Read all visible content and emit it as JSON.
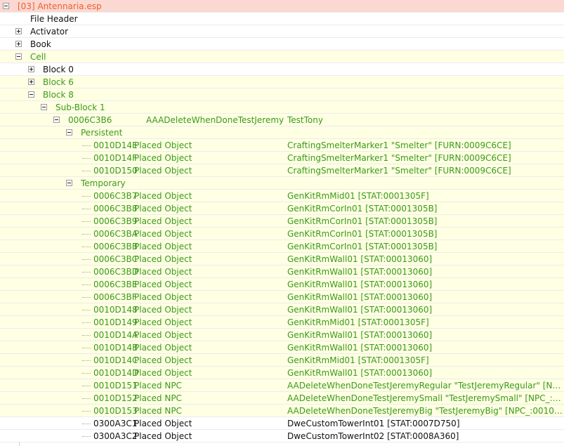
{
  "root": {
    "label": "[03] Antennaria.esp"
  },
  "top_items": {
    "file_header": "File Header",
    "activator": "Activator",
    "book": "Book",
    "cell": "Cell"
  },
  "blocks": {
    "block0": "Block 0",
    "block6": "Block 6",
    "block8": "Block 8",
    "subblock1": "Sub-Block 1"
  },
  "cell_record": {
    "form_id": "0006C3B6",
    "editor_id": "AAADeleteWhenDoneTestJeremy",
    "name": "TestTony"
  },
  "groups": {
    "persistent": "Persistent",
    "temporary": "Temporary"
  },
  "persistent_refs": [
    {
      "id": "0010D14E",
      "type": "Placed Object",
      "base": "CraftingSmelterMarker1 \"Smelter\" [FURN:0009C6CE]"
    },
    {
      "id": "0010D14F",
      "type": "Placed Object",
      "base": "CraftingSmelterMarker1 \"Smelter\" [FURN:0009C6CE]"
    },
    {
      "id": "0010D150",
      "type": "Placed Object",
      "base": "CraftingSmelterMarker1 \"Smelter\" [FURN:0009C6CE]"
    }
  ],
  "temporary_refs": [
    {
      "id": "0006C3B7",
      "type": "Placed Object",
      "base": "GenKitRmMid01 [STAT:0001305F]"
    },
    {
      "id": "0006C3B8",
      "type": "Placed Object",
      "base": "GenKitRmCorIn01 [STAT:0001305B]"
    },
    {
      "id": "0006C3B9",
      "type": "Placed Object",
      "base": "GenKitRmCorIn01 [STAT:0001305B]"
    },
    {
      "id": "0006C3BA",
      "type": "Placed Object",
      "base": "GenKitRmCorIn01 [STAT:0001305B]"
    },
    {
      "id": "0006C3BB",
      "type": "Placed Object",
      "base": "GenKitRmCorIn01 [STAT:0001305B]"
    },
    {
      "id": "0006C3BC",
      "type": "Placed Object",
      "base": "GenKitRmWall01 [STAT:00013060]"
    },
    {
      "id": "0006C3BD",
      "type": "Placed Object",
      "base": "GenKitRmWall01 [STAT:00013060]"
    },
    {
      "id": "0006C3BE",
      "type": "Placed Object",
      "base": "GenKitRmWall01 [STAT:00013060]"
    },
    {
      "id": "0006C3BF",
      "type": "Placed Object",
      "base": "GenKitRmWall01 [STAT:00013060]"
    },
    {
      "id": "0010D148",
      "type": "Placed Object",
      "base": "GenKitRmWall01 [STAT:00013060]"
    },
    {
      "id": "0010D149",
      "type": "Placed Object",
      "base": "GenKitRmMid01 [STAT:0001305F]"
    },
    {
      "id": "0010D14A",
      "type": "Placed Object",
      "base": "GenKitRmWall01 [STAT:00013060]"
    },
    {
      "id": "0010D14B",
      "type": "Placed Object",
      "base": "GenKitRmWall01 [STAT:00013060]"
    },
    {
      "id": "0010D14C",
      "type": "Placed Object",
      "base": "GenKitRmMid01 [STAT:0001305F]"
    },
    {
      "id": "0010D14D",
      "type": "Placed Object",
      "base": "GenKitRmWall01 [STAT:00013060]"
    },
    {
      "id": "0010D151",
      "type": "Placed NPC",
      "base": "AADeleteWhenDoneTestJeremyRegular \"TestJeremyRegular\" [NPC_:001..."
    },
    {
      "id": "0010D152",
      "type": "Placed NPC",
      "base": "AADeleteWhenDoneTestJeremySmall \"TestJeremySmall\" [NPC_:0010D1..."
    },
    {
      "id": "0010D153",
      "type": "Placed NPC",
      "base": "AADeleteWhenDoneTestJeremyBig \"TestJeremyBig\" [NPC_:0010D140]"
    },
    {
      "id": "0300A3C1",
      "type": "Placed Object",
      "base": "DweCustomTowerInt01 [STAT:0007D750]"
    },
    {
      "id": "0300A3C2",
      "type": "Placed Object",
      "base": "DweCustomTowerInt02 [STAT:0008A360]"
    }
  ],
  "colors": {
    "header_bg": "#fbd8d2",
    "header_text": "#f0602a",
    "modified_bg": "#ffffe3",
    "modified_text": "#3a9a1a",
    "normal_text": "#111111"
  }
}
